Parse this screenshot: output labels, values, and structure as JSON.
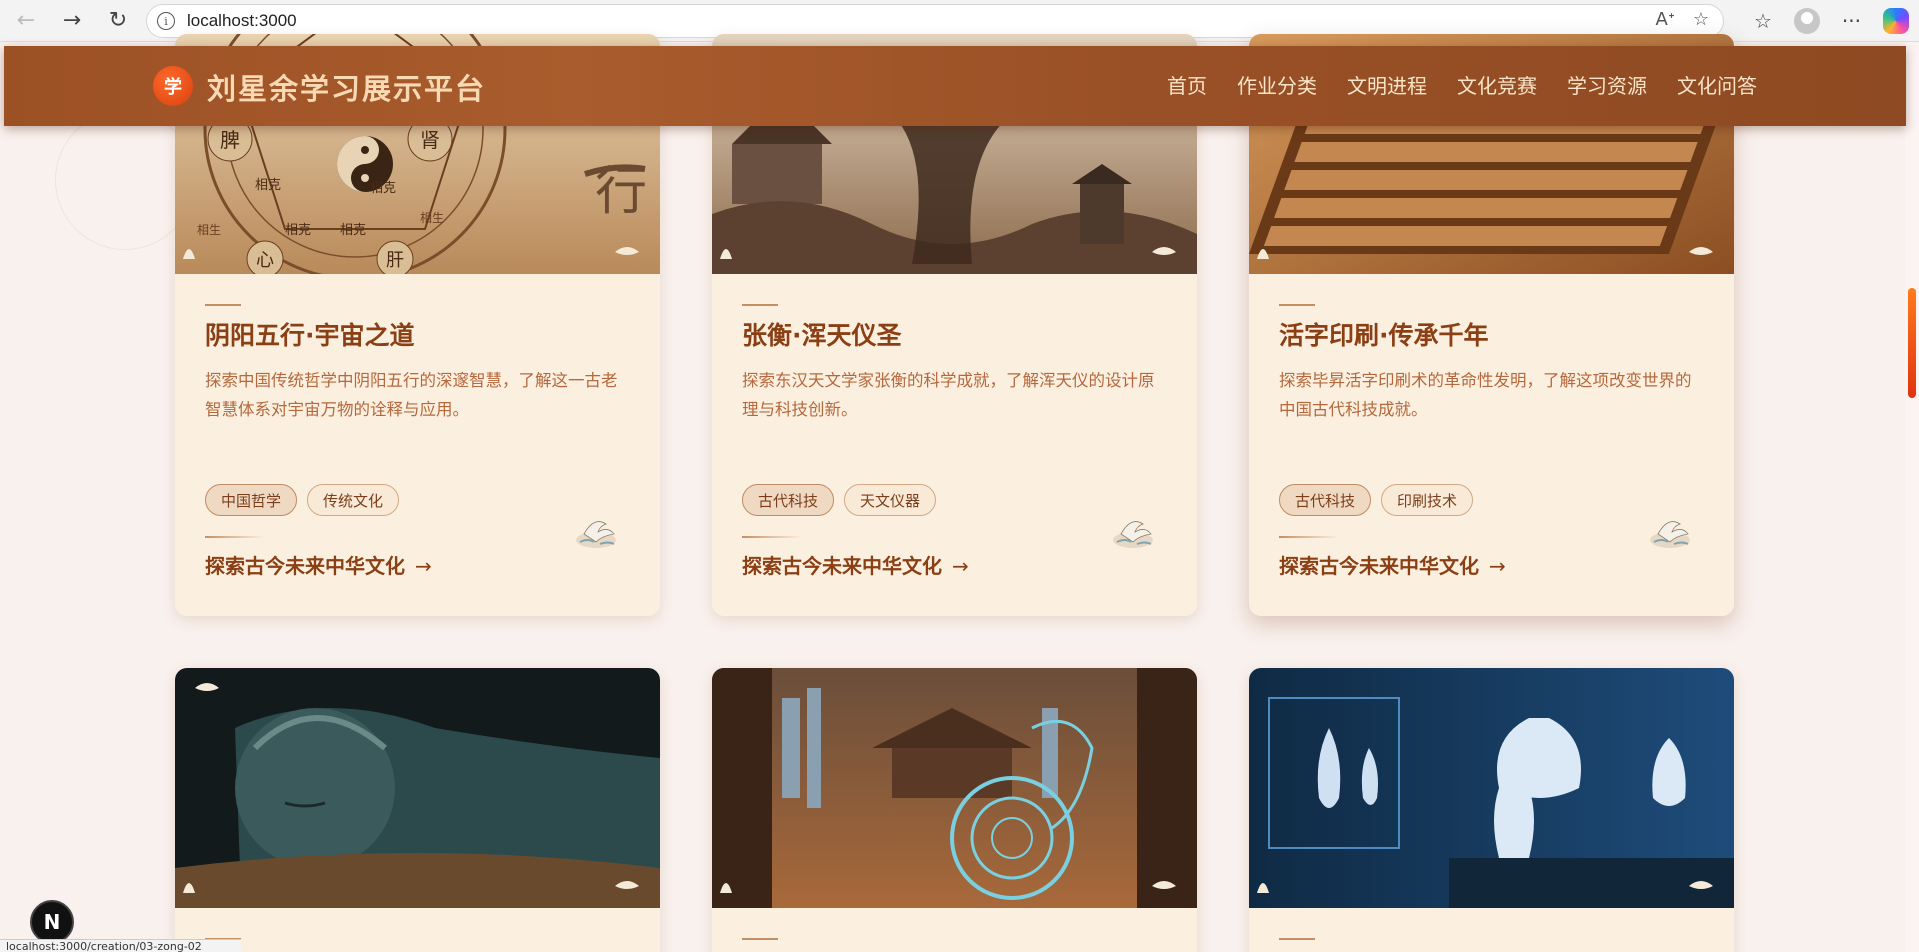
{
  "browser": {
    "url": "localhost:3000",
    "status_url": "localhost:3000/creation/03-zong-02"
  },
  "header": {
    "logo_char": "学",
    "title": "刘星余学习展示平台",
    "nav": [
      "首页",
      "作业分类",
      "文明进程",
      "文化竞赛",
      "学习资源",
      "文化问答"
    ]
  },
  "cards": [
    {
      "title": "阴阳五行·宇宙之道",
      "description": "探索中国传统哲学中阴阳五行的深邃智慧，了解这一古老智慧体系对宇宙万物的诠释与应用。",
      "tags": [
        "中国哲学",
        "传统文化"
      ],
      "link": "探索古今未来中华文化",
      "image_labels": [
        "脾",
        "肾",
        "相克",
        "相克",
        "相克",
        "相克",
        "心",
        "肝",
        "相生",
        "相生",
        "行"
      ]
    },
    {
      "title": "张衡·浑天仪圣",
      "description": "探索东汉天文学家张衡的科学成就，了解浑天仪的设计原理与科技创新。",
      "tags": [
        "古代科技",
        "天文仪器"
      ],
      "link": "探索古今未来中华文化"
    },
    {
      "title": "活字印刷·传承千年",
      "description": "探索毕昇活字印刷术的革命性发明，了解这项改变世界的中国古代科技成就。",
      "tags": [
        "古代科技",
        "印刷技术"
      ],
      "link": "探索古今未来中华文化"
    }
  ],
  "link_arrow": "→",
  "next_badge": "N",
  "colors": {
    "header_bg": "#9c5125",
    "card_bg": "#fbf0df",
    "title_brown": "#8a3f14",
    "desc_orange": "#b5683d",
    "accent_orange": "#e0340f"
  }
}
